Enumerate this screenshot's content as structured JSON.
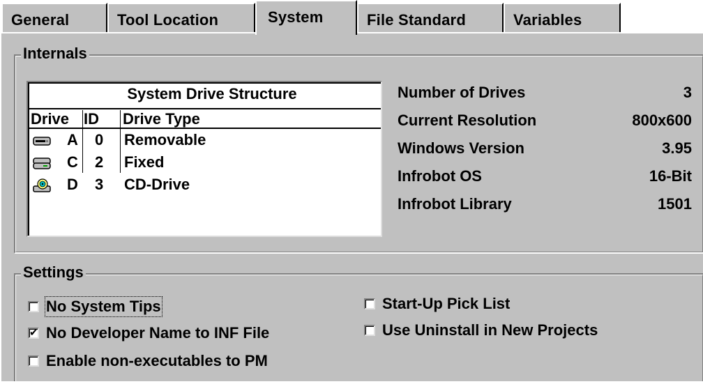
{
  "tabs": [
    {
      "label": "General",
      "active": false
    },
    {
      "label": "Tool Location",
      "active": false
    },
    {
      "label": "System",
      "active": true
    },
    {
      "label": "File Standard",
      "active": false
    },
    {
      "label": "Variables",
      "active": false
    }
  ],
  "internals": {
    "title": "Internals",
    "drive_list": {
      "title": "System Drive Structure",
      "columns": [
        "Drive",
        "ID",
        "Drive Type"
      ],
      "rows": [
        {
          "icon": "removable-drive-icon",
          "drive": "A",
          "id": "0",
          "type": "Removable"
        },
        {
          "icon": "fixed-drive-icon",
          "drive": "C",
          "id": "2",
          "type": "Fixed"
        },
        {
          "icon": "cd-drive-icon",
          "drive": "D",
          "id": "3",
          "type": "CD-Drive"
        }
      ]
    },
    "info": [
      {
        "label": "Number of Drives",
        "value": "3"
      },
      {
        "label": "Current Resolution",
        "value": "800x600"
      },
      {
        "label": "Windows Version",
        "value": "3.95"
      },
      {
        "label": "Infrobot OS",
        "value": "16-Bit"
      },
      {
        "label": "Infrobot Library",
        "value": "1501"
      }
    ]
  },
  "settings": {
    "title": "Settings",
    "checkboxes": [
      {
        "label": "No System Tips",
        "checked": false
      },
      {
        "label": "No Developer Name to INF File",
        "checked": true
      },
      {
        "label": "Enable non-executables to PM",
        "checked": false
      },
      {
        "label": "Start-Up Pick List",
        "checked": false
      },
      {
        "label": "Use Uninstall in New Projects",
        "checked": false
      }
    ]
  },
  "colors": {
    "face": "#c0c0c0",
    "shadow": "#808080",
    "highlight": "#ffffff"
  }
}
